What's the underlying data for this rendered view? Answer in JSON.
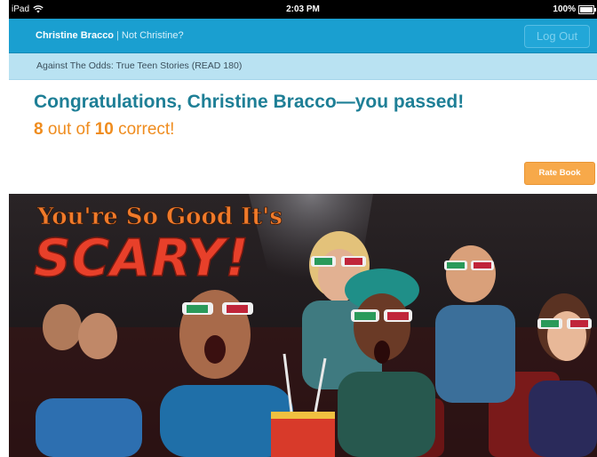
{
  "status_bar": {
    "device": "iPad",
    "time": "2:03 PM",
    "battery": "100%"
  },
  "header": {
    "user_name": "Christine Bracco",
    "separator": "|",
    "not_user_link": "Not Christine?",
    "logout_label": "Log Out"
  },
  "book": {
    "title": "Against The Odds: True Teen Stories (READ 180)"
  },
  "results": {
    "congrats_text": "Congratulations, Christine Bracco—you passed!",
    "score_correct": "8",
    "score_out_of": "out of",
    "score_total": "10",
    "score_suffix": "correct!",
    "rate_button": "Rate Book"
  },
  "cover": {
    "headline_line1": "You're So Good It's",
    "headline_line2": "SCARY!"
  },
  "colors": {
    "topbar": "#1a9fd0",
    "bookbar": "#b9e2f2",
    "congrats": "#1e7f96",
    "score": "#ef8c1e",
    "rate_button": "#f7a94a"
  }
}
